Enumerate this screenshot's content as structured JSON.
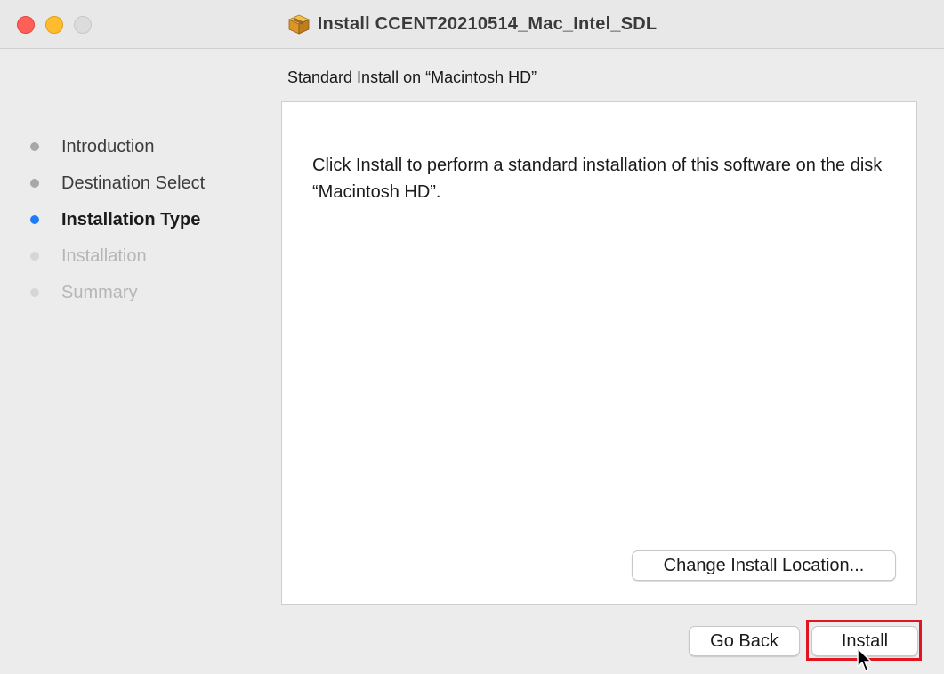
{
  "window": {
    "title": "Install CCENT20210514_Mac_Intel_SDL",
    "title_icon": "package-icon",
    "traffic_lights": {
      "close": "#ff5f57",
      "minimize": "#febc2e",
      "zoom": "#dcdcdc"
    }
  },
  "subtitle": "Standard Install on “Macintosh HD”",
  "steps": [
    {
      "label": "Introduction",
      "state": "done"
    },
    {
      "label": "Destination Select",
      "state": "done"
    },
    {
      "label": "Installation Type",
      "state": "current"
    },
    {
      "label": "Installation",
      "state": "todo"
    },
    {
      "label": "Summary",
      "state": "todo"
    }
  ],
  "content": {
    "message": "Click Install to perform a standard installation of this software on the disk “Macintosh HD”.",
    "change_location_label": "Change Install Location..."
  },
  "footer": {
    "go_back_label": "Go Back",
    "install_label": "Install"
  },
  "colors": {
    "accent": "#1f7bf6",
    "highlight": "#e0151f"
  }
}
